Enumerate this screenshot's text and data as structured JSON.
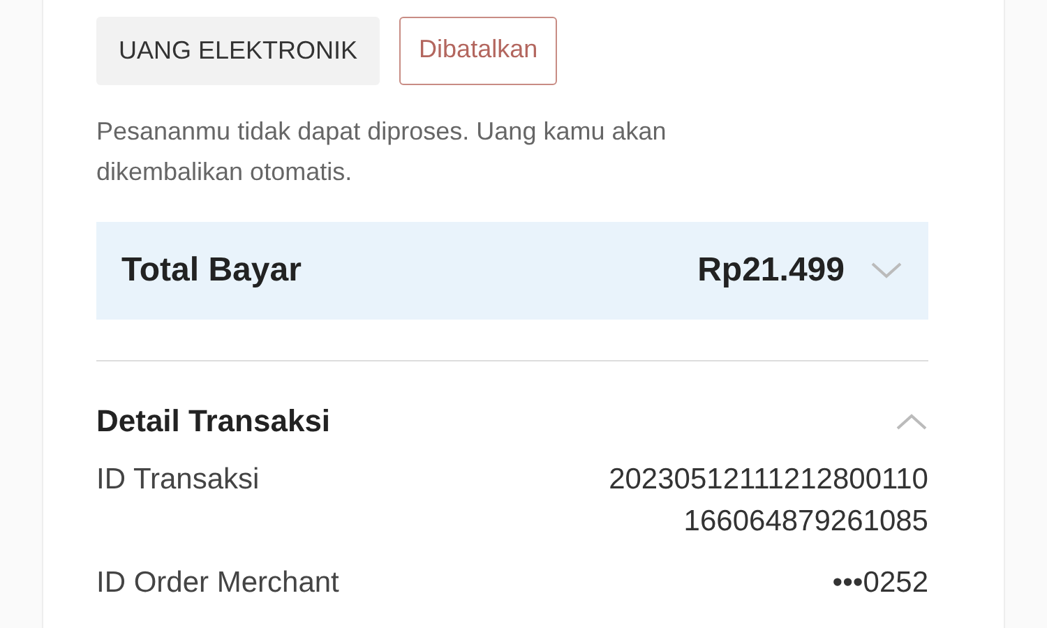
{
  "tags": [
    {
      "label": "UANG ELEKTRONIK",
      "kind": "method"
    },
    {
      "label": "Dibatalkan",
      "kind": "status"
    }
  ],
  "message": "Pesananmu tidak dapat diproses. Uang kamu akan dikembalikan otomatis.",
  "total": {
    "label": "Total Bayar",
    "amount": "Rp21.499",
    "expanded": false
  },
  "details": {
    "title": "Detail Transaksi",
    "expanded": true,
    "rows": [
      {
        "label": "ID Transaksi",
        "value": "20230512111212800110 166064879261085"
      },
      {
        "label": "ID Order Merchant",
        "value": "•••0252"
      }
    ]
  }
}
